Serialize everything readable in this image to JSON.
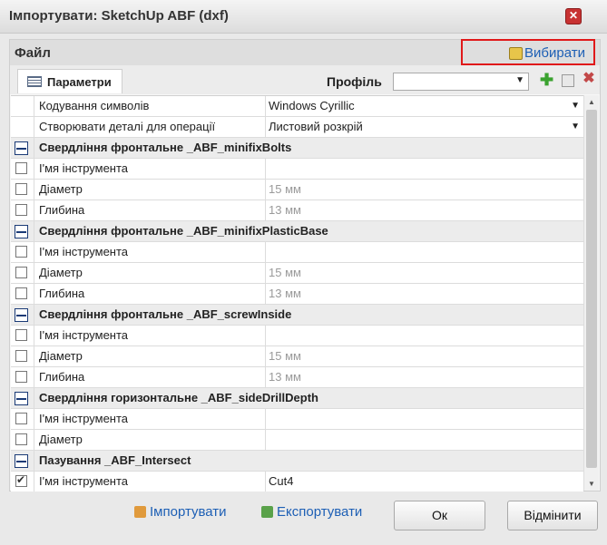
{
  "window": {
    "title": "Імпортувати: SketchUp ABF (dxf)"
  },
  "file_section": {
    "title": "Файл",
    "choose_label": "Вибирати"
  },
  "toolbar": {
    "tab_label": "Параметри",
    "profile_label": "Профіль",
    "profile_value": ""
  },
  "rows": [
    {
      "kind": "prop",
      "label": "Кодування символів",
      "value": "Windows Cyrillic",
      "dropdown": true
    },
    {
      "kind": "prop",
      "label": "Створювати деталі для операції",
      "value": "Листовий розкрій",
      "dropdown": true
    },
    {
      "kind": "group",
      "label": "Свердління фронтальне _ABF_minifixBolts"
    },
    {
      "kind": "check",
      "label": "І'мя інструмента",
      "value": "",
      "checked": false
    },
    {
      "kind": "check",
      "label": "Діаметр",
      "value": "15 мм",
      "checked": false,
      "muted": true
    },
    {
      "kind": "check",
      "label": "Глибина",
      "value": "13 мм",
      "checked": false,
      "muted": true
    },
    {
      "kind": "group",
      "label": "Свердління фронтальне _ABF_minifixPlasticBase"
    },
    {
      "kind": "check",
      "label": "І'мя інструмента",
      "value": "",
      "checked": false
    },
    {
      "kind": "check",
      "label": "Діаметр",
      "value": "15 мм",
      "checked": false,
      "muted": true
    },
    {
      "kind": "check",
      "label": "Глибина",
      "value": "13 мм",
      "checked": false,
      "muted": true
    },
    {
      "kind": "group",
      "label": "Свердління фронтальне _ABF_screwInside"
    },
    {
      "kind": "check",
      "label": "І'мя інструмента",
      "value": "",
      "checked": false
    },
    {
      "kind": "check",
      "label": "Діаметр",
      "value": "15 мм",
      "checked": false,
      "muted": true
    },
    {
      "kind": "check",
      "label": "Глибина",
      "value": "13 мм",
      "checked": false,
      "muted": true
    },
    {
      "kind": "group",
      "label": "Свердління горизонтальне _ABF_sideDrillDepth"
    },
    {
      "kind": "check",
      "label": "І'мя інструмента",
      "value": "",
      "checked": false
    },
    {
      "kind": "check",
      "label": "Діаметр",
      "value": "",
      "checked": false
    },
    {
      "kind": "group",
      "label": "Пазування _ABF_Intersect"
    },
    {
      "kind": "check",
      "label": "І'мя інструмента",
      "value": "Cut4",
      "checked": true
    }
  ],
  "footer": {
    "import_label": "Імпортувати",
    "export_label": "Експортувати",
    "ok_label": "Ок",
    "cancel_label": "Відмінити"
  }
}
